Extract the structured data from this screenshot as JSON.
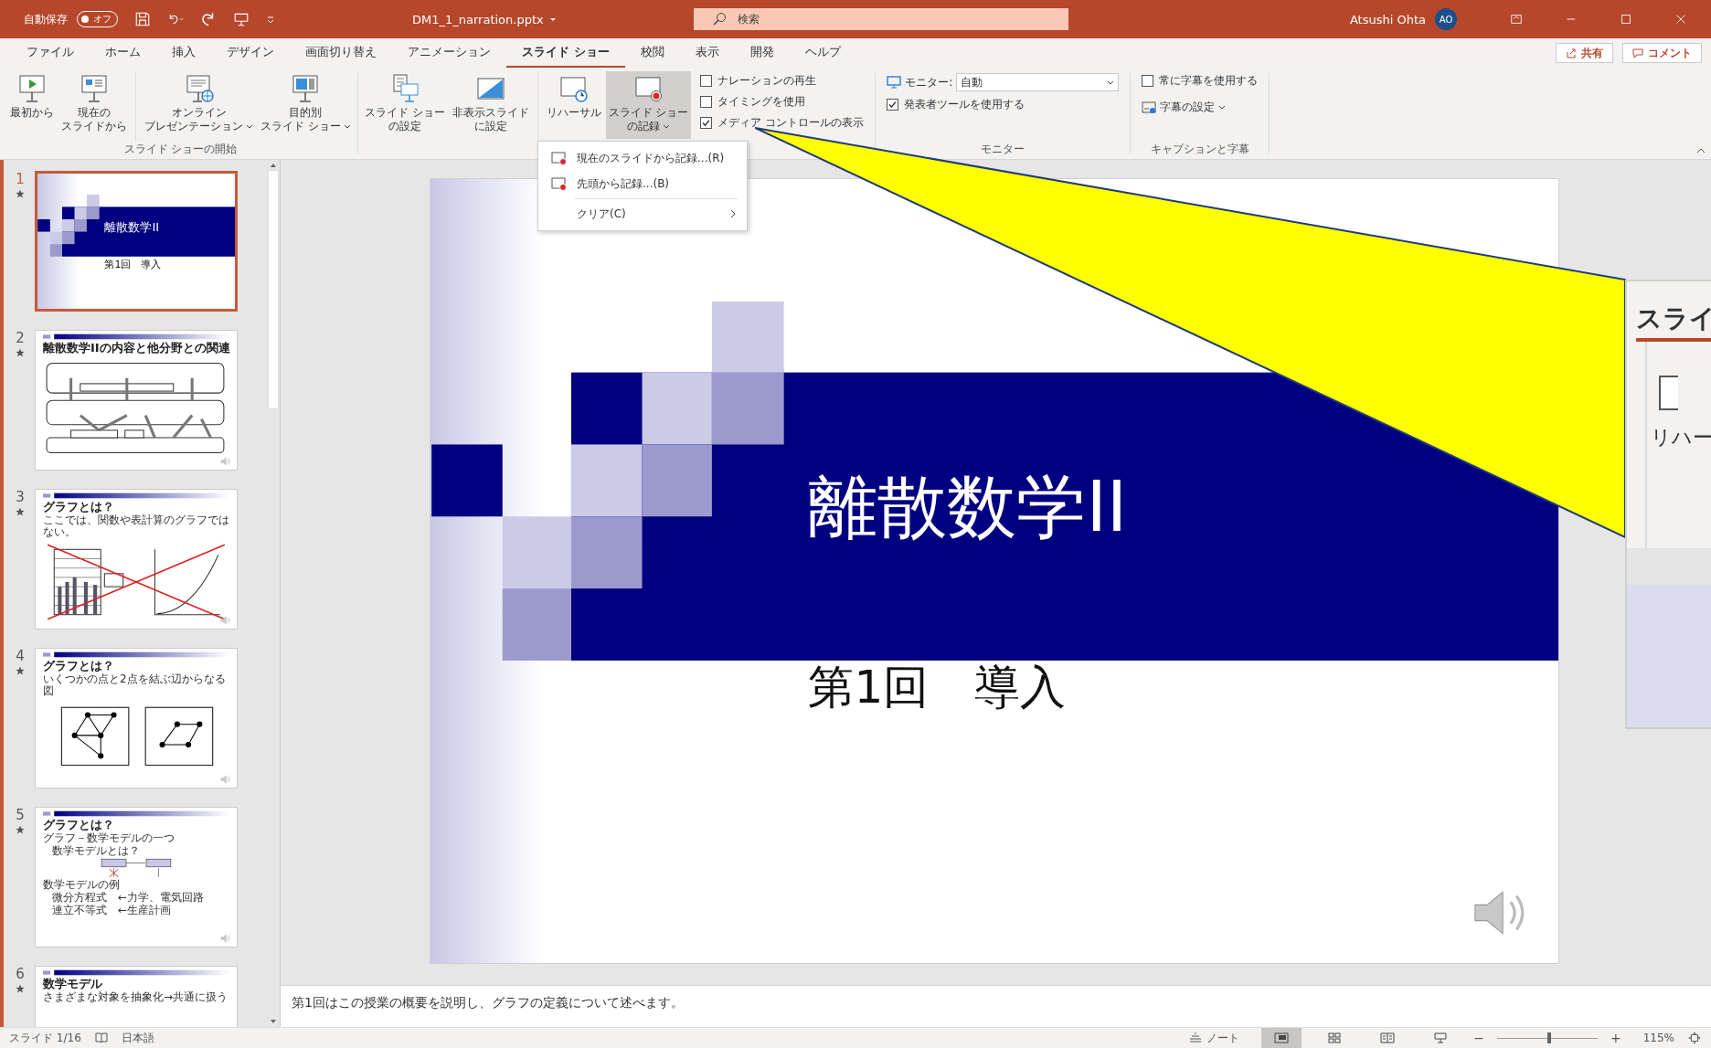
{
  "title_bar": {
    "autosave_label": "自動保存",
    "autosave_state": "オフ",
    "autosave_on": false,
    "file_name": "DM1_1_narration.pptx",
    "search_placeholder": "検索",
    "user_name": "Atsushi Ohta",
    "user_initials": "AO"
  },
  "menu_tabs": [
    {
      "label": "ファイル",
      "selected": false
    },
    {
      "label": "ホーム",
      "selected": false
    },
    {
      "label": "挿入",
      "selected": false
    },
    {
      "label": "デザイン",
      "selected": false
    },
    {
      "label": "画面切り替え",
      "selected": false
    },
    {
      "label": "アニメーション",
      "selected": false
    },
    {
      "label": "スライド ショー",
      "selected": true
    },
    {
      "label": "校閲",
      "selected": false
    },
    {
      "label": "表示",
      "selected": false
    },
    {
      "label": "開発",
      "selected": false
    },
    {
      "label": "ヘルプ",
      "selected": false
    }
  ],
  "share_button": "共有",
  "comment_button": "コメント",
  "ribbon_groups": [
    {
      "label": "スライド ショーの開始",
      "items": [
        {
          "kind": "play",
          "lines": [
            "最初から"
          ],
          "dropdown": false,
          "pressed": false
        },
        {
          "kind": "current",
          "lines": [
            "現在の",
            "スライドから"
          ],
          "dropdown": false,
          "pressed": false
        },
        {
          "kind": "divider"
        },
        {
          "kind": "online",
          "lines": [
            "オンライン",
            "プレゼンテーション"
          ],
          "dropdown": true,
          "pressed": false
        },
        {
          "kind": "custom",
          "lines": [
            "目的別",
            "スライド ショー"
          ],
          "dropdown": true,
          "pressed": false
        }
      ]
    },
    {
      "items": [
        {
          "kind": "setup",
          "lines": [
            "スライド ショー",
            "の設定"
          ],
          "dropdown": false,
          "pressed": false
        },
        {
          "kind": "hide",
          "lines": [
            "非表示スライド",
            "に設定"
          ],
          "dropdown": false,
          "pressed": false
        },
        {
          "kind": "divider"
        },
        {
          "kind": "rehearse",
          "lines": [
            "リハーサル"
          ],
          "dropdown": false,
          "pressed": false
        },
        {
          "kind": "record",
          "lines": [
            "スライド ショー",
            "の記録"
          ],
          "dropdown": true,
          "pressed": true
        }
      ],
      "rows": [
        {
          "kind": "checkbox",
          "label": "ナレーションの再生",
          "checked": false
        },
        {
          "kind": "checkbox",
          "label": "タイミングを使用",
          "checked": false
        },
        {
          "kind": "checkbox",
          "label": "メディア コントロールの表示",
          "checked": true
        }
      ]
    },
    {
      "label": "モニター",
      "rows": [
        {
          "kind": "combo",
          "label": "モニター:",
          "value": "自動"
        },
        {
          "kind": "checkbox",
          "label": "発表者ツールを使用する",
          "checked": true
        }
      ]
    },
    {
      "label": "キャプションと字幕",
      "rows": [
        {
          "kind": "checkbox",
          "label": "常に字幕を使用する",
          "checked": false
        },
        {
          "kind": "menu",
          "label": "字幕の設定"
        }
      ]
    }
  ],
  "record_menu": [
    {
      "kind": "command",
      "label": "現在のスライドから記録...(R)"
    },
    {
      "kind": "command",
      "label": "先頭から記録...(B)"
    },
    {
      "kind": "submenu",
      "label": "クリア(C)"
    }
  ],
  "slides": [
    {
      "number": "1",
      "selected": true,
      "has_animation": true,
      "kind": "title",
      "title": "離散数学II",
      "subtitle": "第1回　導入"
    },
    {
      "number": "2",
      "selected": false,
      "has_animation": true,
      "kind": "diagram",
      "title": "離散数学IIの内容と他分野との関連"
    },
    {
      "number": "3",
      "selected": false,
      "has_animation": true,
      "kind": "charts",
      "title": "グラフとは？",
      "bullets": [
        {
          "text": "ここでは、関数や表計算のグラフではない。"
        }
      ]
    },
    {
      "number": "4",
      "selected": false,
      "has_animation": true,
      "kind": "graphs",
      "title": "グラフとは？",
      "bullets": [
        {
          "text": "いくつかの点と2点を結ぶ辺からなる図"
        }
      ]
    },
    {
      "number": "5",
      "selected": false,
      "has_animation": true,
      "kind": "model",
      "title": "グラフとは？",
      "bullets": [
        {
          "text": "グラフ－数学モデルの一つ",
          "children": [
            {
              "text": "数学モデルとは？"
            }
          ]
        },
        {
          "text": "数学モデルの例",
          "children": [
            {
              "text": "微分方程式　←力学、電気回路"
            },
            {
              "text": "連立不等式　←生産計画"
            }
          ]
        }
      ]
    },
    {
      "number": "6",
      "selected": false,
      "has_animation": true,
      "kind": "text",
      "title": "数学モデル",
      "bullets": [
        {
          "text": "さまざまな対象を抽象化→共通に扱う"
        }
      ]
    }
  ],
  "editor_slide": {
    "title": "離散数学II",
    "subtitle": "第1回　導入"
  },
  "notes": "第1回はこの授業の概要を説明し、グラフの定義について述べます。",
  "callout": {
    "tab_label": "スライ",
    "button_label": "リハー"
  },
  "status_bar": {
    "slide_counter": "スライド 1/16",
    "language": "日本語",
    "notes_button": "ノート",
    "views": [
      {
        "kind": "normal",
        "selected": true
      },
      {
        "kind": "sorter",
        "selected": false
      },
      {
        "kind": "reading",
        "selected": false
      },
      {
        "kind": "slideshow",
        "selected": false
      }
    ],
    "zoom_out": "−",
    "zoom_in": "+",
    "zoom": {
      "level": 0.52
    },
    "zoom_label": "115%"
  }
}
